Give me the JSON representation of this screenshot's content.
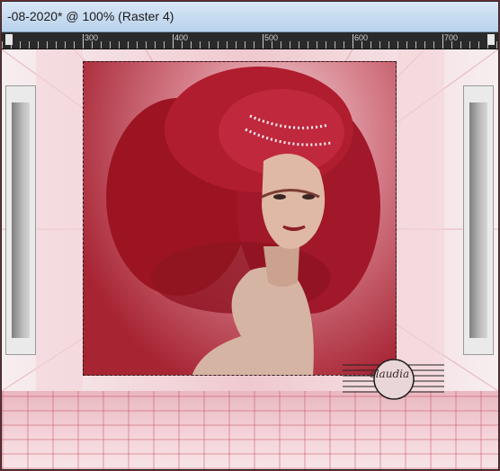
{
  "window": {
    "title": "-08-2020* @ 100% (Raster 4)"
  },
  "ruler": {
    "labels": [
      "300",
      "400",
      "500",
      "600",
      "700"
    ]
  },
  "watermark": {
    "text": "claudia"
  },
  "colors": {
    "title_bar": "#c9dcf0",
    "canvas_accent": "#a72433",
    "background": "#f6ecee"
  },
  "icons": {
    "ruler_marker": "position-marker-icon"
  }
}
